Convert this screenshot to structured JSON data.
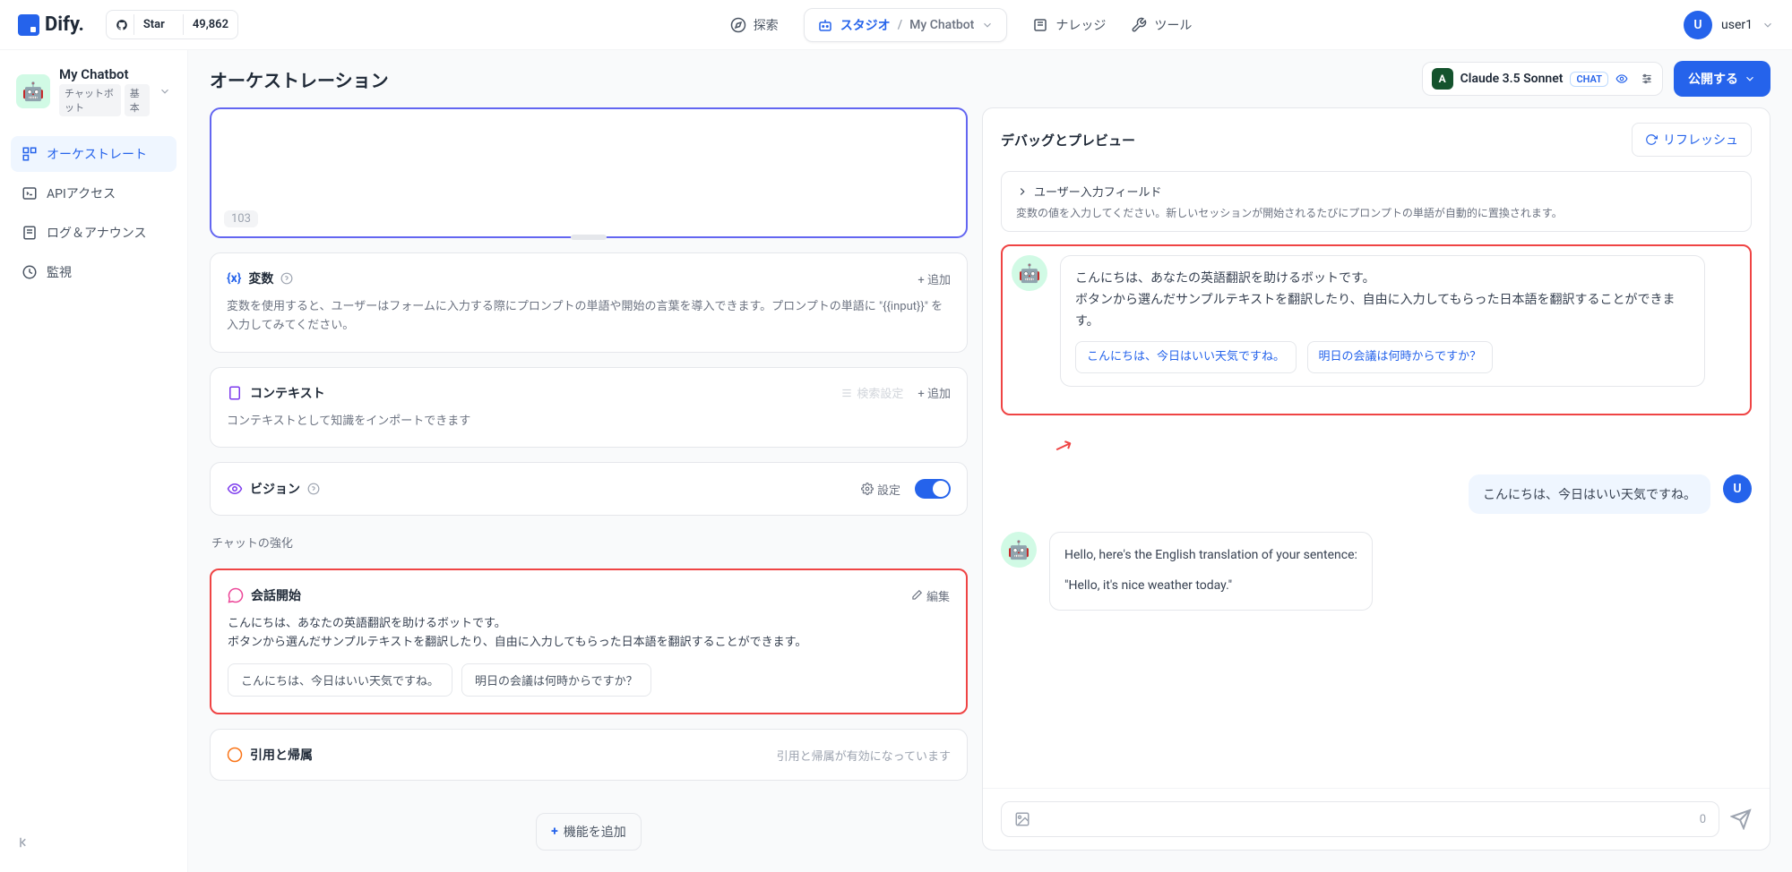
{
  "topNav": {
    "logo": "Dify.",
    "github": {
      "label": "Star",
      "count": "49,862"
    },
    "explore": "探索",
    "studio": "スタジオ",
    "currentApp": "My Chatbot",
    "knowledge": "ナレッジ",
    "tools": "ツール",
    "user": {
      "initial": "U",
      "name": "user1"
    }
  },
  "sidebar": {
    "appName": "My Chatbot",
    "tags": [
      "チャットボット",
      "基本"
    ],
    "nav": {
      "orchestrate": "オーケストレート",
      "api": "APIアクセス",
      "logs": "ログ＆アナウンス",
      "overview": "監視"
    }
  },
  "header": {
    "title": "オーケストレーション",
    "model": "Claude 3.5 Sonnet",
    "modelTag": "CHAT",
    "publish": "公開する"
  },
  "orch": {
    "promptCounter": "103",
    "variables": {
      "title": "変数",
      "add": "+ 追加",
      "desc": "変数を使用すると、ユーザーはフォームに入力する際にプロンプトの単語や開始の言葉を導入できます。プロンプトの単語に \"{{input}}\" を入力してみてください。"
    },
    "context": {
      "title": "コンテキスト",
      "searchSettings": "検索設定",
      "add": "+ 追加",
      "desc": "コンテキストとして知識をインポートできます"
    },
    "vision": {
      "title": "ビジョン",
      "settings": "設定"
    },
    "enhanceLabel": "チャットの強化",
    "opener": {
      "title": "会話開始",
      "edit": "編集",
      "body": "こんにちは、あなたの英語翻訳を助けるボットです。\nボタンから選んだサンプルテキストを翻訳したり、自由に入力してもらった日本語を翻訳することができます。",
      "chips": [
        "こんにちは、今日はいい天気ですね。",
        "明日の会議は何時からですか？"
      ]
    },
    "citation": {
      "title": "引用と帰属",
      "status": "引用と帰属が有効になっています"
    },
    "addFeature": "機能を追加"
  },
  "preview": {
    "title": "デバッグとプレビュー",
    "refresh": "リフレッシュ",
    "inputVars": {
      "title": "ユーザー入力フィールド",
      "desc": "変数の値を入力してください。新しいセッションが開始されるたびにプロンプトの単語が自動的に置換されます。"
    },
    "botGreeting": "こんにちは、あなたの英語翻訳を助けるボットです。\nボタンから選んだサンプルテキストを翻訳したり、自由に入力してもらった日本語を翻訳することができます。",
    "suggestions": [
      "こんにちは、今日はいい天気ですね。",
      "明日の会議は何時からですか？"
    ],
    "userMsg": "こんにちは、今日はいい天気ですね。",
    "botReply1": "Hello, here's the English translation of your sentence:",
    "botReply2": "\"Hello, it's nice weather today.\"",
    "inputCounter": "0"
  }
}
